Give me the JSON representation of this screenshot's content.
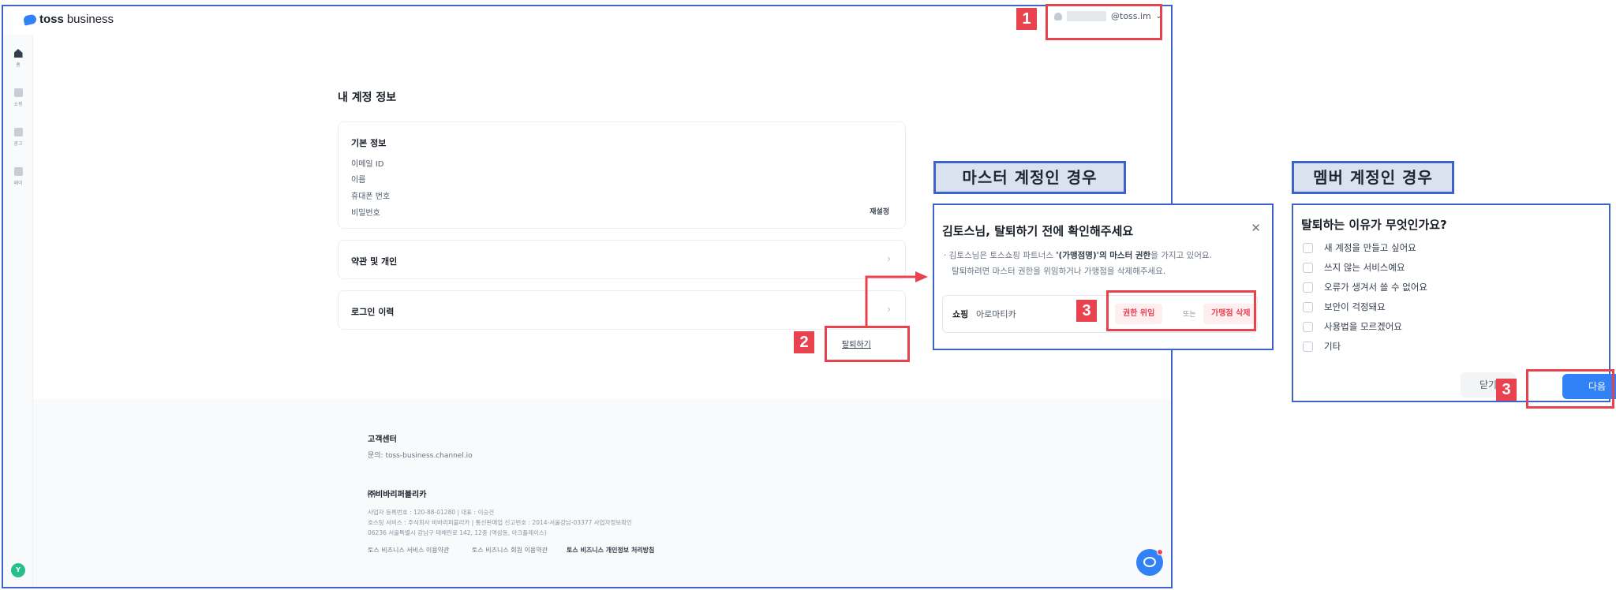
{
  "app": {
    "logo_text": "toss",
    "logo_suffix": "business",
    "account_email": "@toss.im",
    "avatar_initial": "Y"
  },
  "sidebar": {
    "items": [
      {
        "label": "홈",
        "icon": "home-icon"
      },
      {
        "label": "쇼핑",
        "icon": "shopping-bag-icon"
      },
      {
        "label": "광고",
        "icon": "ad-icon"
      },
      {
        "label": "페이",
        "icon": "pay-icon"
      }
    ]
  },
  "account_page": {
    "title": "내 계정 정보",
    "basic_info": {
      "title": "기본 정보",
      "fields": [
        "이메일 ID",
        "이름",
        "휴대폰 번호",
        "비밀번호"
      ],
      "reset_label": "재설정"
    },
    "terms_row": "약관 및 개인",
    "login_history_row": "로그인 이력",
    "withdraw_link": "탈퇴하기"
  },
  "footer": {
    "support_title": "고객센터",
    "support_contact": "문의: toss-business.channel.io",
    "company_name": "㈜비바리퍼블리카",
    "company_lines": [
      "사업자 등록번호 : 120-88-01280 | 대표 : 이승건",
      "호스팅 서비스 : 주식회사 비바리퍼블리카 | 통신판매업 신고번호 : 2014-서울강남-03377 사업자정보확인",
      "06236 서울특별시 강남구 테헤란로 142, 12층 (역삼동, 아크플레이스)"
    ],
    "links": [
      "토스 비즈니스 서비스 이용약관",
      "토스 비즈니스 회원 이용약관",
      "토스 비즈니스 개인정보 처리방침"
    ]
  },
  "annotations": {
    "markers": [
      "1",
      "2",
      "3",
      "3"
    ],
    "master_heading": "마스터 계정인 경우",
    "member_heading": "멤버 계정인 경우"
  },
  "master_dialog": {
    "title": "김토스님, 탈퇴하기 전에 확인해주세요",
    "line1_prefix": "· 김토스님은 토스쇼핑 파트너스 ",
    "line1_bold": "'(가맹점명)'의 마스터 권한",
    "line1_suffix": "을 가지고 있어요.",
    "line2": "탈퇴하려면 마스터 권한을 위임하거나 가맹점을 삭제해주세요.",
    "store_type": "쇼핑",
    "store_name": "아로마티카",
    "delegate_button": "권한 위임",
    "or_text": "또는",
    "delete_button": "가맹점 삭제"
  },
  "member_dialog": {
    "title": "탈퇴하는 이유가 무엇인가요?",
    "reasons": [
      "새 계정을 만들고 싶어요",
      "쓰지 않는 서비스예요",
      "오류가 생겨서 쓸 수 없어요",
      "보안이 걱정돼요",
      "사용법을 모르겠어요",
      "기타"
    ],
    "close_button": "닫기",
    "next_button": "다음"
  },
  "colors": {
    "frame_border": "#3b63c9",
    "marker": "#e8424f",
    "primary": "#3182f6",
    "heading_bg": "#dbe2ef"
  }
}
